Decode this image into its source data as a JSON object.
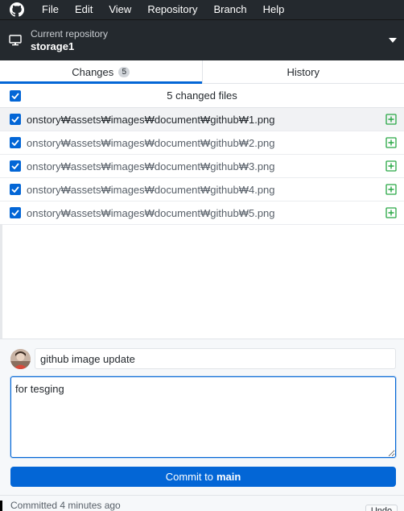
{
  "menubar": {
    "items": [
      "File",
      "Edit",
      "View",
      "Repository",
      "Branch",
      "Help"
    ]
  },
  "repo": {
    "label": "Current repository",
    "name": "storage1"
  },
  "tabs": {
    "changes_label": "Changes",
    "changes_count": "5",
    "history_label": "History"
  },
  "file_list": {
    "summary": "5 changed files",
    "files": [
      "onstory₩assets₩images₩document₩github₩1.png",
      "onstory₩assets₩images₩document₩github₩2.png",
      "onstory₩assets₩images₩document₩github₩3.png",
      "onstory₩assets₩images₩document₩github₩4.png",
      "onstory₩assets₩images₩document₩github₩5.png"
    ]
  },
  "commit": {
    "summary_value": "github image update",
    "description_value": "for tesging",
    "button_prefix": "Commit to",
    "branch": "main"
  },
  "footer": {
    "committed": "Committed 4 minutes ago",
    "undo_label": "Undo"
  },
  "colors": {
    "accent": "#0366d6",
    "titlebar": "#24292e",
    "added": "#28a745"
  },
  "icons": {
    "app": "github-logo-icon",
    "repo": "monitor-icon",
    "dropdown": "caret-down-icon",
    "check": "checkbox-checked-icon",
    "file_status": "file-added-icon"
  }
}
